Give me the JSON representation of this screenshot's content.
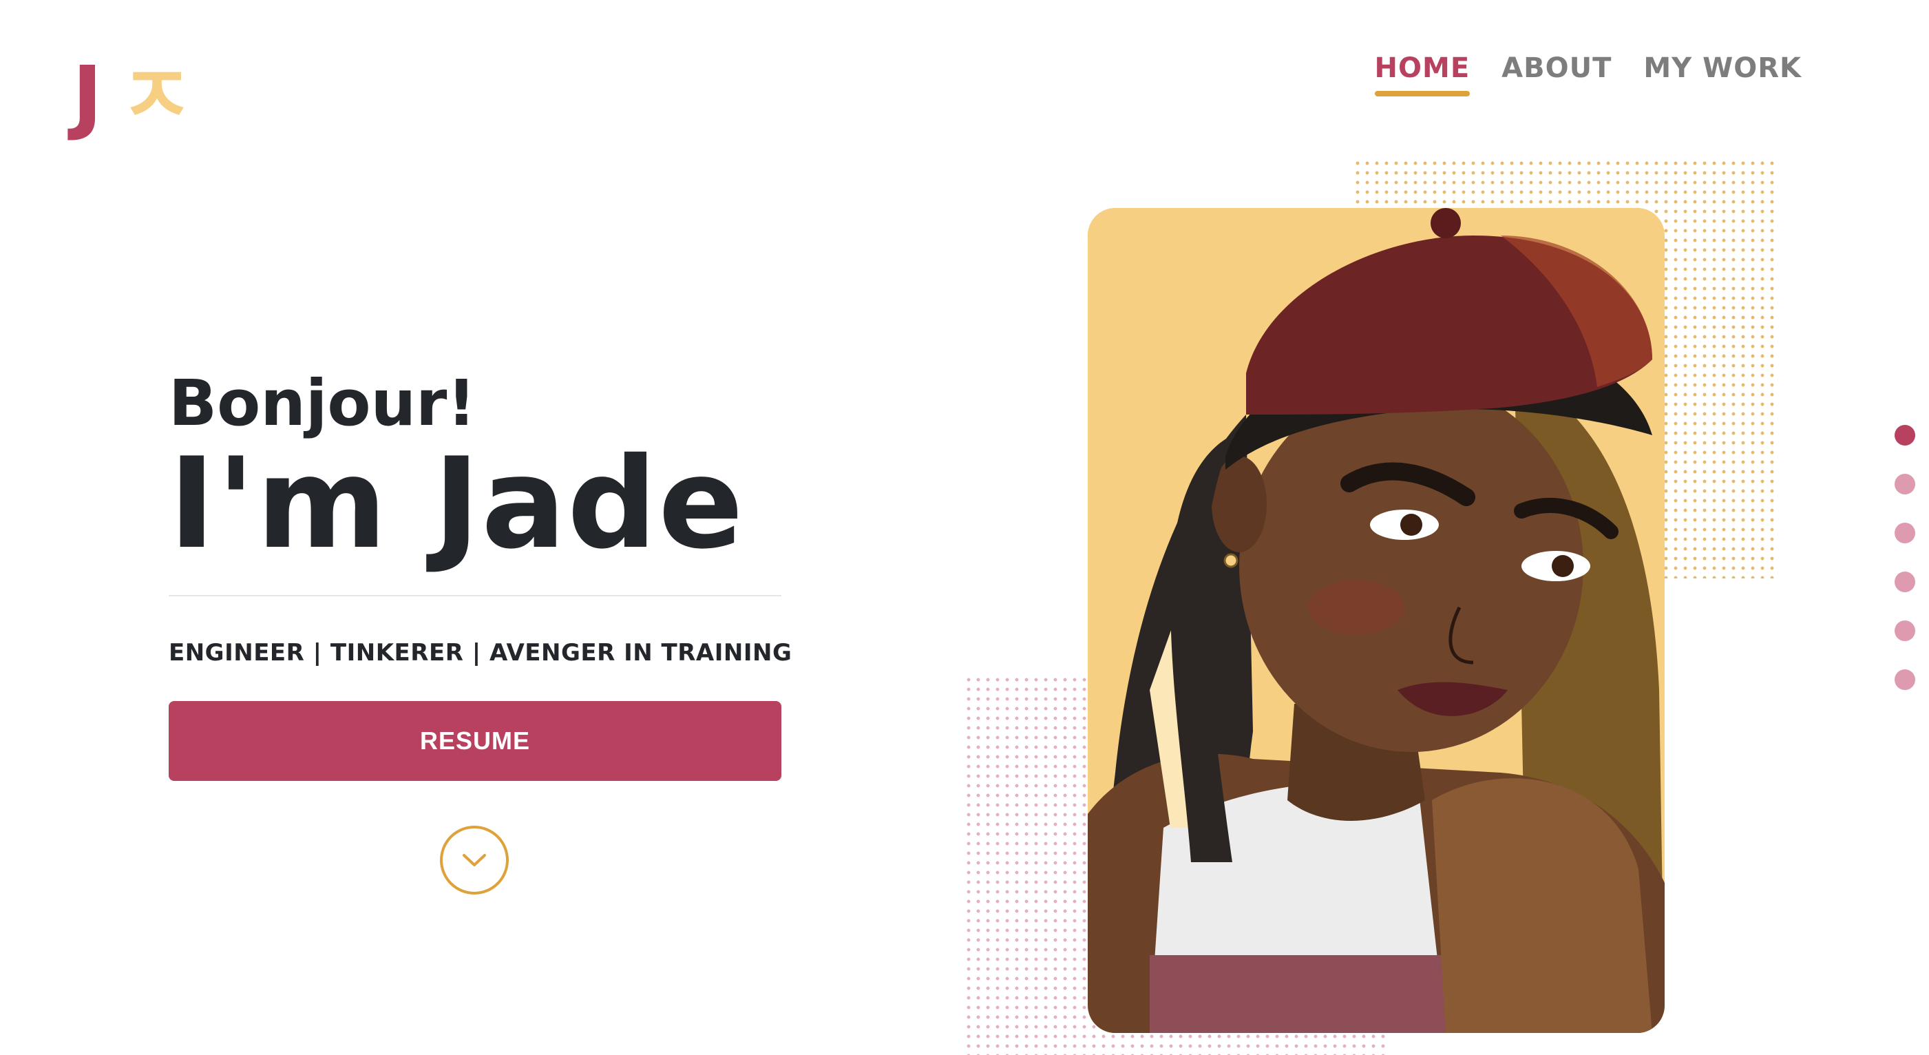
{
  "colors": {
    "pink": "#b7415f",
    "pink_light": "#de9bb0",
    "yellow": "#f6cf82",
    "gold": "#dfa13a",
    "text": "#23262b"
  },
  "logo": {
    "letter": "J",
    "mark": "ㅈ"
  },
  "nav": {
    "items": [
      {
        "label": "HOME",
        "active": true
      },
      {
        "label": "ABOUT",
        "active": false
      },
      {
        "label": "MY WORK",
        "active": false
      }
    ]
  },
  "hero": {
    "greeting": "Bonjour!",
    "name": "I'm Jade",
    "tagline": "ENGINEER | TINKERER | AVENGER IN TRAINING",
    "resume_label": "RESUME"
  },
  "pager": {
    "count": 6,
    "active_index": 0
  },
  "icons": {
    "scroll": "chevron-down-icon",
    "portrait": "illustrated-portrait"
  }
}
